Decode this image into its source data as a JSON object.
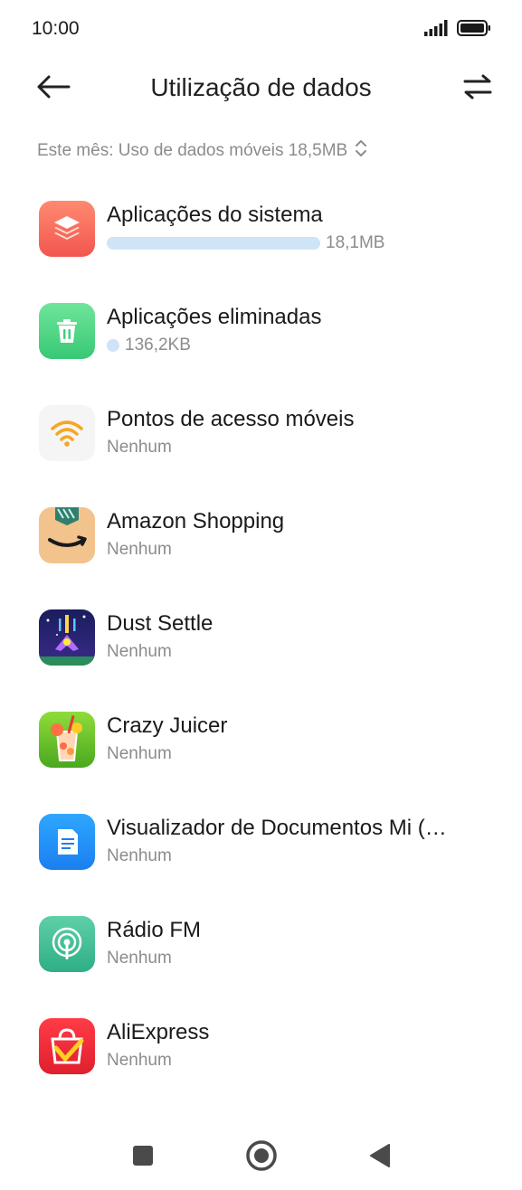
{
  "status": {
    "time": "10:00"
  },
  "header": {
    "title": "Utilização de dados"
  },
  "month": {
    "label": "Este mês: Uso de dados móveis 18,5MB"
  },
  "apps": [
    {
      "name": "Aplicações do sistema",
      "usage": "18,1MB",
      "usage_fraction": 1.0,
      "icon": "layers-icon"
    },
    {
      "name": "Aplicações eliminadas",
      "usage": "136,2KB",
      "usage_fraction": 0.01,
      "icon": "trash-icon"
    },
    {
      "name": "Pontos de acesso móveis",
      "usage": "Nenhum",
      "icon": "wifi-icon"
    },
    {
      "name": "Amazon Shopping",
      "usage": "Nenhum",
      "icon": "amazon-icon"
    },
    {
      "name": "Dust Settle",
      "usage": "Nenhum",
      "icon": "dust-settle-icon"
    },
    {
      "name": "Crazy Juicer",
      "usage": "Nenhum",
      "icon": "crazy-juicer-icon"
    },
    {
      "name": "Visualizador de Documentos Mi (…",
      "usage": "Nenhum",
      "icon": "mi-document-icon"
    },
    {
      "name": "Rádio FM",
      "usage": "Nenhum",
      "icon": "radio-fm-icon"
    },
    {
      "name": "AliExpress",
      "usage": "Nenhum",
      "icon": "aliexpress-icon"
    }
  ],
  "colors": {
    "usage_bar": "#cfe4f7",
    "secondary_text": "#8c8c8c"
  }
}
